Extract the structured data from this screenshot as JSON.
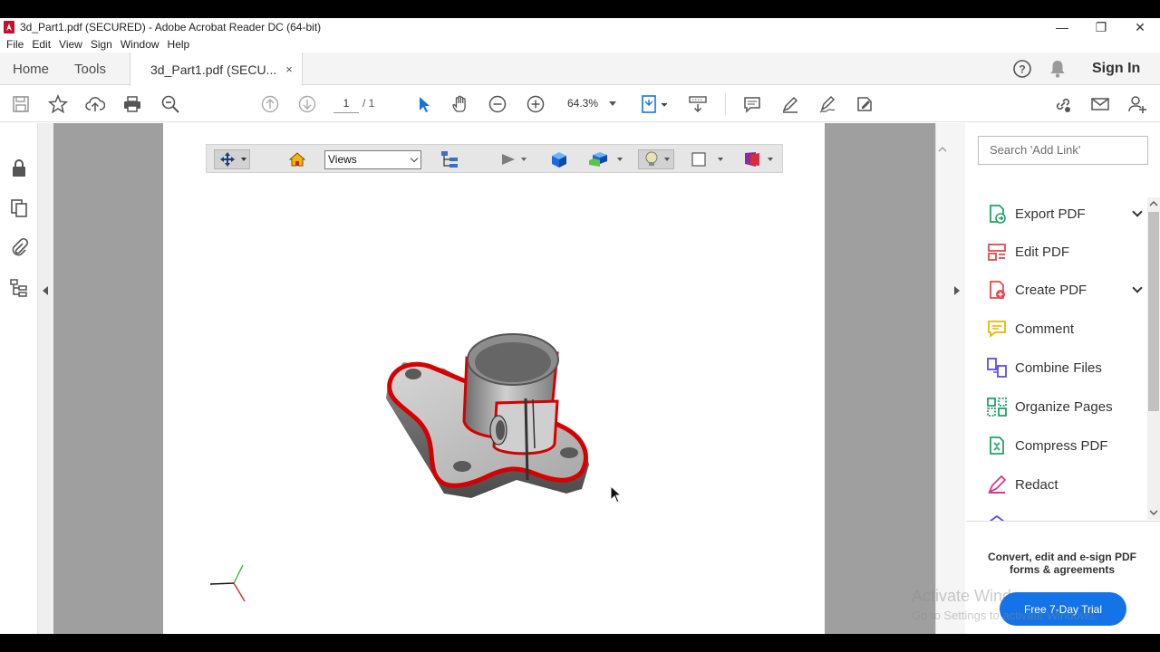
{
  "window": {
    "title": "3d_Part1.pdf (SECURED) - Adobe Acrobat Reader DC (64-bit)",
    "minimize": "—",
    "restore": "❐",
    "close": "✕"
  },
  "menu": [
    "File",
    "Edit",
    "View",
    "Sign",
    "Window",
    "Help"
  ],
  "tabs": {
    "home": "Home",
    "tools": "Tools",
    "doc": "3d_Part1.pdf (SECU...",
    "close": "×"
  },
  "header_right": {
    "sign_in": "Sign In"
  },
  "toolbar": {
    "page_current": "1",
    "page_total": "/ 1",
    "zoom": "64.3%"
  },
  "viewer3d": {
    "views_select": "Views"
  },
  "right_panel": {
    "search_placeholder": "Search 'Add Link'",
    "items": [
      {
        "label": "Export PDF",
        "expandable": true,
        "icon": "export-pdf-icon",
        "color": "#21a366"
      },
      {
        "label": "Edit PDF",
        "expandable": false,
        "icon": "edit-pdf-icon",
        "color": "#e34850"
      },
      {
        "label": "Create PDF",
        "expandable": true,
        "icon": "create-pdf-icon",
        "color": "#e34850"
      },
      {
        "label": "Comment",
        "expandable": false,
        "icon": "comment-icon",
        "color": "#e8b800"
      },
      {
        "label": "Combine Files",
        "expandable": false,
        "icon": "combine-files-icon",
        "color": "#5c4ee5"
      },
      {
        "label": "Organize Pages",
        "expandable": false,
        "icon": "organize-pages-icon",
        "color": "#21a366"
      },
      {
        "label": "Compress PDF",
        "expandable": false,
        "icon": "compress-pdf-icon",
        "color": "#21a366"
      },
      {
        "label": "Redact",
        "expandable": false,
        "icon": "redact-icon",
        "color": "#d03a8c"
      }
    ],
    "promo_text": "Convert, edit and e-sign PDF forms & agreements",
    "trial_button": "Free 7-Day Trial"
  },
  "watermark": {
    "line1": "Activate Windows",
    "line2": "Go to Settings to activate Windows."
  },
  "colors": {
    "accent": "#1473e6",
    "doc_bg": "#9f9f9f"
  }
}
